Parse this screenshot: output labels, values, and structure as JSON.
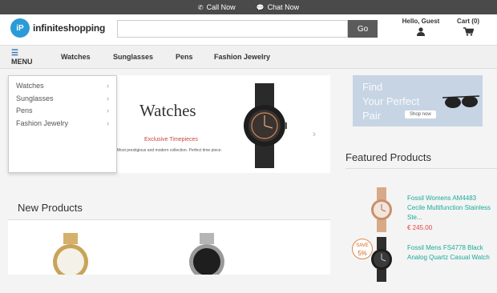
{
  "topbar": {
    "call_label": "Call Now",
    "chat_label": "Chat Now"
  },
  "header": {
    "logo_mark": "iP",
    "logo_text": "infiniteshopping",
    "search": {
      "value": "",
      "placeholder": "",
      "button_label": "Go"
    },
    "account_label": "Hello, Guest",
    "cart_label": "Cart (0)"
  },
  "nav": {
    "menu_label": "MENU",
    "links": [
      "Watches",
      "Sunglasses",
      "Pens",
      "Fashion Jewelry"
    ]
  },
  "dropdown": {
    "items": [
      "Watches",
      "Sunglasses",
      "Pens",
      "Fashion Jewelry"
    ]
  },
  "slider": {
    "title": "Watches",
    "subtitle": "Exclusive Timepieces",
    "description": "Most prestigious and modern collection. Perfect time piece."
  },
  "promo": {
    "line1": "Find",
    "line2": "Your Perfect",
    "line3": "Pair",
    "button_label": "Shop now"
  },
  "featured": {
    "title": "Featured Products",
    "products": [
      {
        "name": "Fossil Womens AM4483 Cecile Multifunction Stainless Ste...",
        "price": "€ 245.00"
      },
      {
        "name": "Fossil Mens FS4778 Black Analog Quartz Casual Watch",
        "badge_top": "SAVE",
        "badge_bottom": "5%"
      }
    ]
  },
  "new_products": {
    "title": "New Products"
  },
  "colors": {
    "topbar_bg": "#4a4a4a",
    "accent_teal": "#1aab9b",
    "price_red": "#e64343",
    "logo_blue": "#2b9bd8"
  }
}
